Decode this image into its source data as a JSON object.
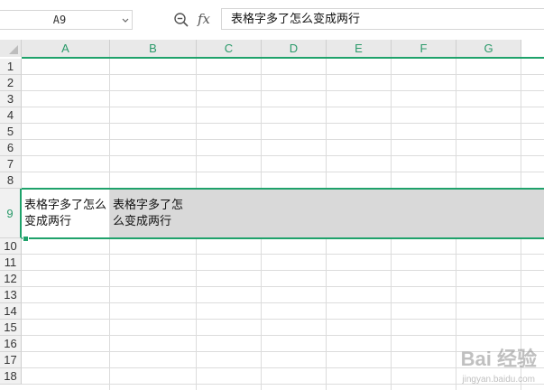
{
  "formula_bar": {
    "name_box": "A9",
    "fx_label": "fx",
    "formula": "表格字多了怎么变成两行"
  },
  "grid": {
    "columns": [
      "A",
      "B",
      "C",
      "D",
      "E",
      "F",
      "G"
    ],
    "rows": [
      "1",
      "2",
      "3",
      "4",
      "5",
      "6",
      "7",
      "8",
      "9",
      "10",
      "11",
      "12",
      "13",
      "14",
      "15",
      "16",
      "17",
      "18"
    ],
    "selected_row": "9",
    "cells": {
      "A9": "表格字多了怎么变成两行",
      "B9": "表格字多了怎么变成两行"
    }
  },
  "watermark": {
    "text": "Bai 经验",
    "sub": "jingyan.baidu.com"
  },
  "colors": {
    "accent": "#1fa26b",
    "selection_fill": "#d9d9d9",
    "header_bg": "#e9e9e9"
  },
  "icons": [
    "zoom-icon",
    "fx-icon",
    "chevron-down-icon",
    "select-all-icon"
  ]
}
